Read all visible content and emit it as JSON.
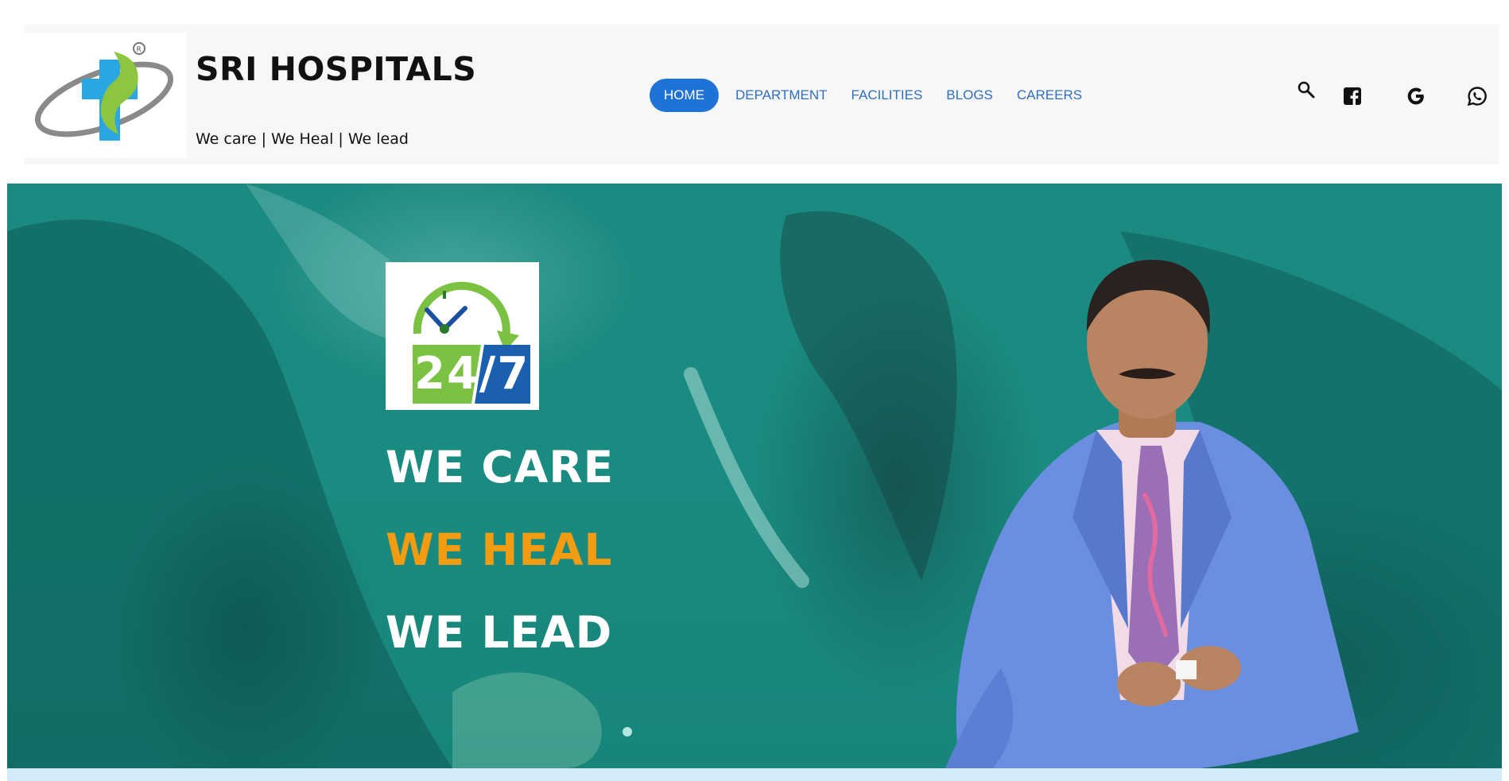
{
  "header": {
    "title": "SRI HOSPITALS",
    "tagline": "We care | We Heal | We lead"
  },
  "nav": {
    "items": [
      {
        "label": "HOME",
        "active": true
      },
      {
        "label": "DEPARTMENT",
        "active": false
      },
      {
        "label": "FACILITIES",
        "active": false
      },
      {
        "label": "BLOGS",
        "active": false
      },
      {
        "label": "CAREERS",
        "active": false
      }
    ],
    "active_color": "#1f73d6",
    "link_color": "#2f6fc0"
  },
  "header_icons": [
    "search-icon",
    "facebook-icon",
    "google-icon",
    "whatsapp-icon"
  ],
  "hero": {
    "badge_text": "24/7",
    "lines": [
      "WE CARE",
      "WE HEAL",
      "WE LEAD"
    ],
    "accent_color": "#f39c12",
    "background_color": "#1a8b80"
  }
}
